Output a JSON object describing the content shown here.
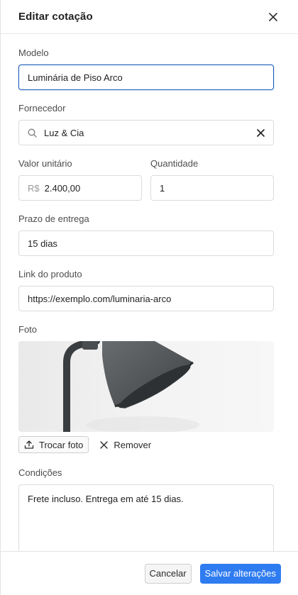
{
  "header": {
    "title": "Editar cotação"
  },
  "form": {
    "modelo": {
      "label": "Modelo",
      "value": "Luminária de Piso Arco"
    },
    "fornecedor": {
      "label": "Fornecedor",
      "value": "Luz & Cia"
    },
    "valor": {
      "label": "Valor unitário",
      "prefix": "R$",
      "value": "2.400,00"
    },
    "quantidade": {
      "label": "Quantidade",
      "value": "1"
    },
    "prazo": {
      "label": "Prazo de entrega",
      "value": "15 dias"
    },
    "link": {
      "label": "Link do produto",
      "value": "https://exemplo.com/luminaria-arco"
    },
    "foto": {
      "label": "Foto",
      "change_label": "Trocar foto",
      "remove_label": "Remover"
    },
    "condicoes": {
      "label": "Condições",
      "value": "Frete incluso. Entrega em até 15 dias."
    }
  },
  "footer": {
    "cancel_label": "Cancelar",
    "save_label": "Salvar alterações"
  },
  "colors": {
    "accent": "#2f7cf0",
    "focus_border": "#1f5fbf"
  },
  "icons": [
    "close-icon",
    "search-icon",
    "clear-icon",
    "upload-icon",
    "remove-icon"
  ]
}
